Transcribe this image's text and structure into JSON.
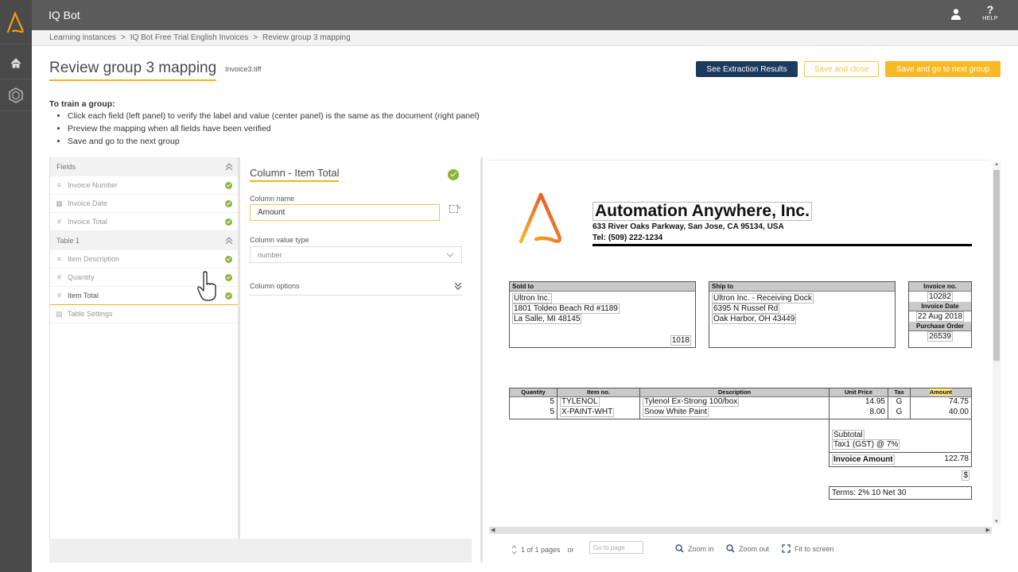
{
  "app": {
    "title": "IQ Bot",
    "help_label": "HELP",
    "help_glyph": "?"
  },
  "breadcrumb": [
    "Learning instances",
    "IQ Bot Free Trial English Invoices",
    "Review group 3 mapping"
  ],
  "header": {
    "title": "Review group 3 mapping",
    "file": "Invoice3.tiff",
    "buttons": {
      "see_results": "See Extraction Results",
      "save_close": "Save and close",
      "save_next": "Save and go to next group"
    }
  },
  "instructions": {
    "heading": "To train a group:",
    "items": [
      "Click each field (left panel) to verify the label and value (center panel) is the same as the document (right panel)",
      "Preview the mapping when all fields have been verified",
      "Save and go to the next group"
    ]
  },
  "fields_panel": {
    "fields_header": "Fields",
    "fields": [
      "Invoice Number",
      "Invoice Date",
      "Invoice Total"
    ],
    "table_header": "Table 1",
    "table_items": [
      "Item Description",
      "Quantity",
      "Item Total"
    ],
    "table_settings": "Table Settings"
  },
  "column_panel": {
    "title": "Column - Item Total",
    "name_label": "Column name",
    "name_value": "Amount",
    "draw_label": "Draw",
    "type_label": "Column value type",
    "type_value": "number",
    "options_label": "Column options"
  },
  "viewer": {
    "page_info": "1 of 1 pages",
    "or": "or",
    "goto_placeholder": "Go to page",
    "zoom_in": "Zoom in",
    "zoom_out": "Zoom out",
    "fit": "Fit to screen"
  },
  "invoice": {
    "company": "Automation Anywhere, Inc.",
    "address_line": "633 River Oaks Parkway, San Jose, CA 95134, USA",
    "tel_label": "Tel:",
    "tel": "(509) 222-1234",
    "sold_to": {
      "header": "Sold to",
      "lines": [
        "Ultron Inc.",
        "1801 Toldeo Beach Rd #1189",
        "La Salle, MI 48145"
      ],
      "code": "1018"
    },
    "ship_to": {
      "header": "Ship to",
      "lines": [
        "Ultron Inc. - Receiving Dock",
        "6395 N Russel Rd",
        "Oak Harbor, OH 43449"
      ]
    },
    "meta": {
      "invoice_no_label": "Invoice no.",
      "invoice_no": "10282",
      "date_label": "Invoice Date",
      "date": "22 Aug 2018",
      "po_label": "Purchase Order",
      "po": "26539"
    },
    "table_headers": [
      "Quantity",
      "Item no.",
      "Description",
      "Unit Price",
      "Tax",
      "Amount"
    ],
    "rows": [
      [
        "5",
        "TYLENOL",
        "Tylenol Ex-Strong 100/box",
        "14.95",
        "G",
        "74.75"
      ],
      [
        "5",
        "X-PAINT-WHT",
        "Snow White Paint",
        "8.00",
        "G",
        "40.00"
      ]
    ],
    "subtotal_label": "Subtotal",
    "tax_label": "Tax1 (GST) @ 7%",
    "invoice_amount_label": "Invoice Amount",
    "invoice_amount": "122.78",
    "currency": "$",
    "terms": "Terms: 2% 10   Net 30"
  },
  "colors": {
    "accent": "#f2b21b",
    "primary": "#1d3a5f",
    "success": "#8cb33a",
    "topbar": "#5b5b5b"
  }
}
